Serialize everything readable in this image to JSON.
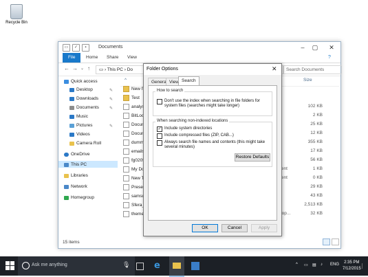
{
  "desktop": {
    "recycle_bin_label": "Recycle Bin"
  },
  "explorer": {
    "title": "Documents",
    "ribbon_tabs": [
      "File",
      "Home",
      "Share",
      "View"
    ],
    "address_path": [
      "This PC",
      "Do"
    ],
    "search_placeholder": "Search Documents",
    "column_headers": {
      "size": "Size"
    },
    "nav": {
      "quick_access": "Quick access",
      "items": [
        "Desktop",
        "Downloads",
        "Documents",
        "Music",
        "Pictures",
        "Videos",
        "Camera Roll"
      ],
      "onedrive": "OneDrive",
      "this_pc": "This PC",
      "libraries": "Libraries",
      "network": "Network",
      "homegroup": "Homegroup"
    },
    "files": [
      {
        "name": "New fo",
        "size": "",
        "type": "",
        "folder": true
      },
      {
        "name": "Test",
        "size": "",
        "type": "",
        "folder": true
      },
      {
        "name": "analys",
        "size": "102 KB",
        "type": ""
      },
      {
        "name": "BitLoc",
        "size": "2 KB",
        "type": ""
      },
      {
        "name": "Docum",
        "size": "25 KB",
        "type": ""
      },
      {
        "name": "Docum",
        "size": "12 KB",
        "type": ""
      },
      {
        "name": "dumm",
        "size": "355 KB",
        "type": ""
      },
      {
        "name": "emails",
        "size": "17 KB",
        "type": ""
      },
      {
        "name": "fg0205",
        "size": "56 KB",
        "type": ""
      },
      {
        "name": "My Do",
        "size": "1 KB",
        "type": "ocument"
      },
      {
        "name": "New T",
        "size": "0 KB",
        "type": "ocument"
      },
      {
        "name": "Presen",
        "size": "29 KB",
        "type": ""
      },
      {
        "name": "samsu",
        "size": "43 KB",
        "type": ""
      },
      {
        "name": "Sfera_",
        "size": "2,513 KB",
        "type": ""
      },
      {
        "name": "theme",
        "size": "32 KB",
        "type": "Desktop..."
      }
    ],
    "status": "15 items"
  },
  "dialog": {
    "title": "Folder Options",
    "tabs": [
      "General",
      "View",
      "Search"
    ],
    "how_to_search": {
      "title": "How to search",
      "option": "Don't use the index when searching in file folders for system files (searches might take longer)",
      "checked": false
    },
    "non_indexed": {
      "title": "When searching non-indexed locations",
      "options": [
        {
          "label": "Include system directories",
          "checked": true
        },
        {
          "label": "Include compressed files (ZIP, CAB...)",
          "checked": false
        },
        {
          "label": "Always search file names and contents (this might take several minutes)",
          "checked": false
        }
      ]
    },
    "restore_defaults": "Restore Defaults",
    "ok": "OK",
    "cancel": "Cancel",
    "apply": "Apply"
  },
  "taskbar": {
    "search_placeholder": "Ask me anything",
    "language": "ENG",
    "time": "2:35 PM",
    "date": "7/12/2015"
  }
}
